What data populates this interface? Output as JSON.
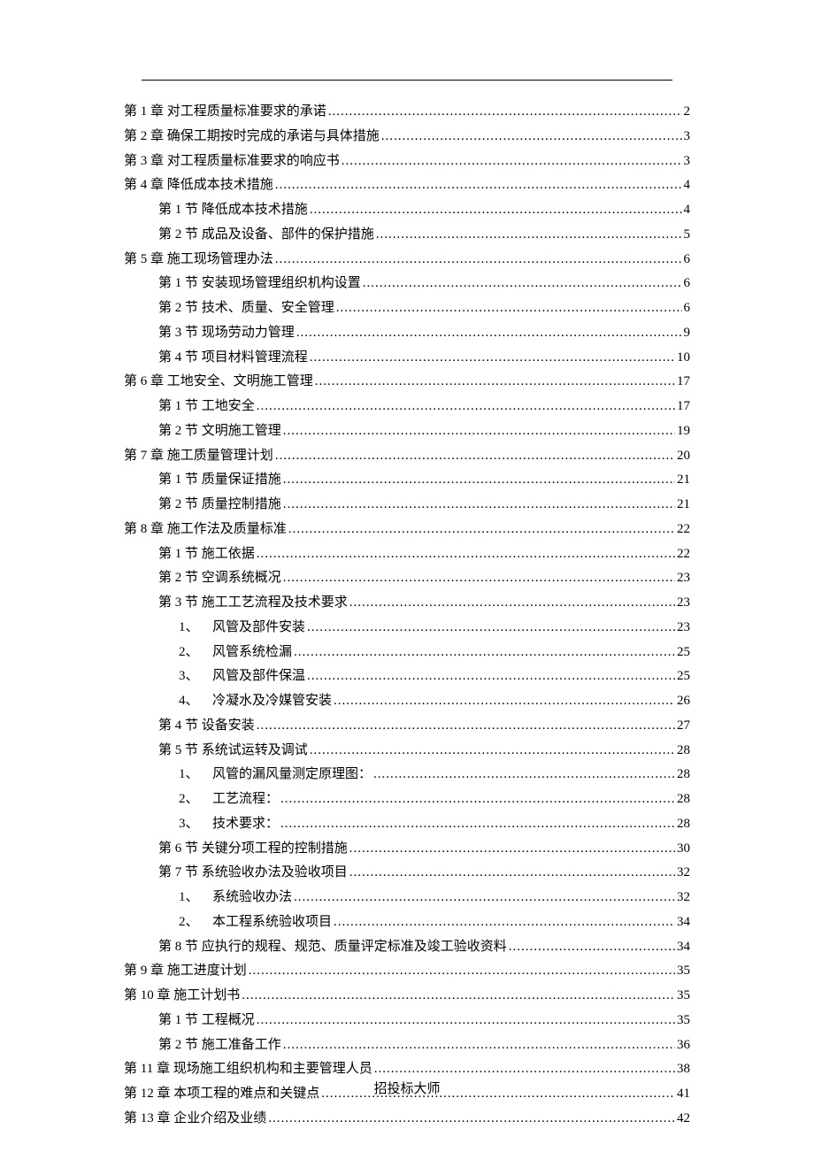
{
  "footer": "招投标大师",
  "toc": [
    {
      "indent": 0,
      "label": "第 1 章  对工程质量标准要求的承诺",
      "page": "2"
    },
    {
      "indent": 0,
      "label": "第 2 章  确保工期按时完成的承诺与具体措施",
      "page": "3"
    },
    {
      "indent": 0,
      "label": "第 3 章  对工程质量标准要求的响应书",
      "page": "3"
    },
    {
      "indent": 0,
      "label": "第 4 章  降低成本技术措施",
      "page": "4"
    },
    {
      "indent": 1,
      "label": "第 1 节  降低成本技术措施",
      "page": "4"
    },
    {
      "indent": 1,
      "label": "第 2 节  成品及设备、部件的保护措施",
      "page": "5"
    },
    {
      "indent": 0,
      "label": "第 5 章  施工现场管理办法",
      "page": "6"
    },
    {
      "indent": 1,
      "label": "第 1 节  安装现场管理组织机构设置",
      "page": "6"
    },
    {
      "indent": 1,
      "label": "第 2 节  技术、质量、安全管理",
      "page": "6"
    },
    {
      "indent": 1,
      "label": "第 3 节  现场劳动力管理",
      "page": "9"
    },
    {
      "indent": 1,
      "label": "第 4 节  项目材料管理流程",
      "page": "10"
    },
    {
      "indent": 0,
      "label": "第 6 章  工地安全、文明施工管理",
      "page": "17"
    },
    {
      "indent": 1,
      "label": "第 1 节  工地安全",
      "page": "17"
    },
    {
      "indent": 1,
      "label": "第 2 节  文明施工管理",
      "page": "19"
    },
    {
      "indent": 0,
      "label": "第 7 章  施工质量管理计划",
      "page": "20"
    },
    {
      "indent": 1,
      "label": "第 1 节  质量保证措施",
      "page": "21"
    },
    {
      "indent": 1,
      "label": "第 2 节  质量控制措施",
      "page": "21"
    },
    {
      "indent": 0,
      "label": "第 8 章  施工作法及质量标准",
      "page": "22"
    },
    {
      "indent": 1,
      "label": "第 1 节  施工依据",
      "page": "22"
    },
    {
      "indent": 1,
      "label": "第 2 节  空调系统概况",
      "page": "23"
    },
    {
      "indent": 1,
      "label": "第 3 节  施工工艺流程及技术要求",
      "page": "23"
    },
    {
      "indent": 2,
      "num": "1、",
      "label": "风管及部件安装",
      "page": "23"
    },
    {
      "indent": 2,
      "num": "2、",
      "label": "风管系统检漏",
      "page": "25"
    },
    {
      "indent": 2,
      "num": "3、",
      "label": "风管及部件保温",
      "page": "25"
    },
    {
      "indent": 2,
      "num": "4、",
      "label": "冷凝水及冷媒管安装",
      "page": "26"
    },
    {
      "indent": 1,
      "label": "第 4 节  设备安装",
      "page": "27"
    },
    {
      "indent": 1,
      "label": "第 5 节  系统试运转及调试",
      "page": "28"
    },
    {
      "indent": 2,
      "num": "1、",
      "label": "风管的漏风量测定原理图：",
      "page": "28"
    },
    {
      "indent": 2,
      "num": "2、",
      "label": "工艺流程：",
      "page": "28"
    },
    {
      "indent": 2,
      "num": "3、",
      "label": "技术要求：",
      "page": "28"
    },
    {
      "indent": 1,
      "label": "第 6 节  关键分项工程的控制措施",
      "page": "30"
    },
    {
      "indent": 1,
      "label": "第 7 节  系统验收办法及验收项目",
      "page": "32"
    },
    {
      "indent": 2,
      "num": "1、",
      "label": "系统验收办法",
      "page": "32"
    },
    {
      "indent": 2,
      "num": "2、",
      "label": "本工程系统验收项目",
      "page": "34"
    },
    {
      "indent": 1,
      "label": "第 8 节  应执行的规程、规范、质量评定标准及竣工验收资料",
      "page": "34"
    },
    {
      "indent": 0,
      "label": "第 9 章  施工进度计划",
      "page": "35"
    },
    {
      "indent": 0,
      "label": "第 10 章  施工计划书",
      "page": "35"
    },
    {
      "indent": 1,
      "label": "第 1 节  工程概况",
      "page": "35"
    },
    {
      "indent": 1,
      "label": "第 2 节  施工准备工作",
      "page": "36"
    },
    {
      "indent": 0,
      "label": "第 11 章  现场施工组织机构和主要管理人员",
      "page": "38"
    },
    {
      "indent": 0,
      "label": "第 12 章  本项工程的难点和关键点",
      "page": "41"
    },
    {
      "indent": 0,
      "label": "第 13 章  企业介绍及业绩",
      "page": "42"
    }
  ]
}
